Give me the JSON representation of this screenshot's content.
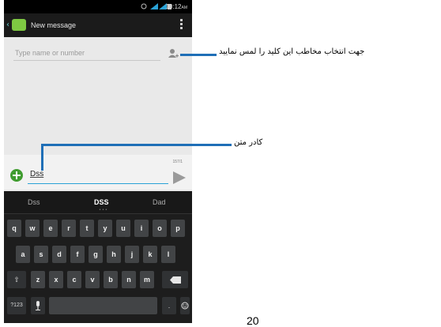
{
  "status_bar": {
    "time": "10:12",
    "ampm": "AM"
  },
  "action_bar": {
    "title": "New message"
  },
  "recipient": {
    "placeholder": "Type name or number"
  },
  "compose": {
    "text": "Dss",
    "counter": "157/1"
  },
  "keyboard": {
    "suggestions": [
      "Dss",
      "DSS",
      "Dad"
    ],
    "row1": [
      "q",
      "w",
      "e",
      "r",
      "t",
      "y",
      "u",
      "i",
      "o",
      "p"
    ],
    "row2": [
      "a",
      "s",
      "d",
      "f",
      "g",
      "h",
      "j",
      "k",
      "l"
    ],
    "row3": [
      "z",
      "x",
      "c",
      "v",
      "b",
      "n",
      "m"
    ],
    "sym_key": "?123",
    "period_key": "."
  },
  "annotations": {
    "contact_hint": "جهت انتخاب مخاطب این کلید را لمس نمایید",
    "text_box": "کادر متن"
  },
  "page_number": "20",
  "colors": {
    "callout": "#1f6fb7",
    "accent": "#2aa2d6",
    "attach": "#3f9c2f"
  }
}
